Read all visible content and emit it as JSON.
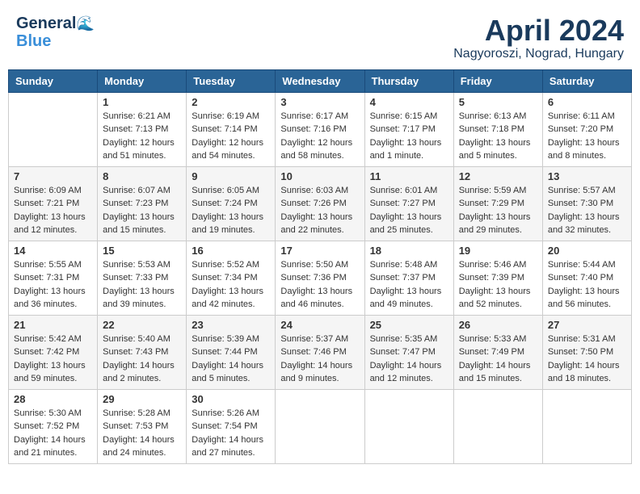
{
  "logo": {
    "line1": "General",
    "line2": "Blue"
  },
  "header": {
    "title": "April 2024",
    "location": "Nagyoroszi, Nograd, Hungary"
  },
  "weekdays": [
    "Sunday",
    "Monday",
    "Tuesday",
    "Wednesday",
    "Thursday",
    "Friday",
    "Saturday"
  ],
  "weeks": [
    [
      {
        "day": "",
        "info": ""
      },
      {
        "day": "1",
        "info": "Sunrise: 6:21 AM\nSunset: 7:13 PM\nDaylight: 12 hours\nand 51 minutes."
      },
      {
        "day": "2",
        "info": "Sunrise: 6:19 AM\nSunset: 7:14 PM\nDaylight: 12 hours\nand 54 minutes."
      },
      {
        "day": "3",
        "info": "Sunrise: 6:17 AM\nSunset: 7:16 PM\nDaylight: 12 hours\nand 58 minutes."
      },
      {
        "day": "4",
        "info": "Sunrise: 6:15 AM\nSunset: 7:17 PM\nDaylight: 13 hours\nand 1 minute."
      },
      {
        "day": "5",
        "info": "Sunrise: 6:13 AM\nSunset: 7:18 PM\nDaylight: 13 hours\nand 5 minutes."
      },
      {
        "day": "6",
        "info": "Sunrise: 6:11 AM\nSunset: 7:20 PM\nDaylight: 13 hours\nand 8 minutes."
      }
    ],
    [
      {
        "day": "7",
        "info": "Sunrise: 6:09 AM\nSunset: 7:21 PM\nDaylight: 13 hours\nand 12 minutes."
      },
      {
        "day": "8",
        "info": "Sunrise: 6:07 AM\nSunset: 7:23 PM\nDaylight: 13 hours\nand 15 minutes."
      },
      {
        "day": "9",
        "info": "Sunrise: 6:05 AM\nSunset: 7:24 PM\nDaylight: 13 hours\nand 19 minutes."
      },
      {
        "day": "10",
        "info": "Sunrise: 6:03 AM\nSunset: 7:26 PM\nDaylight: 13 hours\nand 22 minutes."
      },
      {
        "day": "11",
        "info": "Sunrise: 6:01 AM\nSunset: 7:27 PM\nDaylight: 13 hours\nand 25 minutes."
      },
      {
        "day": "12",
        "info": "Sunrise: 5:59 AM\nSunset: 7:29 PM\nDaylight: 13 hours\nand 29 minutes."
      },
      {
        "day": "13",
        "info": "Sunrise: 5:57 AM\nSunset: 7:30 PM\nDaylight: 13 hours\nand 32 minutes."
      }
    ],
    [
      {
        "day": "14",
        "info": "Sunrise: 5:55 AM\nSunset: 7:31 PM\nDaylight: 13 hours\nand 36 minutes."
      },
      {
        "day": "15",
        "info": "Sunrise: 5:53 AM\nSunset: 7:33 PM\nDaylight: 13 hours\nand 39 minutes."
      },
      {
        "day": "16",
        "info": "Sunrise: 5:52 AM\nSunset: 7:34 PM\nDaylight: 13 hours\nand 42 minutes."
      },
      {
        "day": "17",
        "info": "Sunrise: 5:50 AM\nSunset: 7:36 PM\nDaylight: 13 hours\nand 46 minutes."
      },
      {
        "day": "18",
        "info": "Sunrise: 5:48 AM\nSunset: 7:37 PM\nDaylight: 13 hours\nand 49 minutes."
      },
      {
        "day": "19",
        "info": "Sunrise: 5:46 AM\nSunset: 7:39 PM\nDaylight: 13 hours\nand 52 minutes."
      },
      {
        "day": "20",
        "info": "Sunrise: 5:44 AM\nSunset: 7:40 PM\nDaylight: 13 hours\nand 56 minutes."
      }
    ],
    [
      {
        "day": "21",
        "info": "Sunrise: 5:42 AM\nSunset: 7:42 PM\nDaylight: 13 hours\nand 59 minutes."
      },
      {
        "day": "22",
        "info": "Sunrise: 5:40 AM\nSunset: 7:43 PM\nDaylight: 14 hours\nand 2 minutes."
      },
      {
        "day": "23",
        "info": "Sunrise: 5:39 AM\nSunset: 7:44 PM\nDaylight: 14 hours\nand 5 minutes."
      },
      {
        "day": "24",
        "info": "Sunrise: 5:37 AM\nSunset: 7:46 PM\nDaylight: 14 hours\nand 9 minutes."
      },
      {
        "day": "25",
        "info": "Sunrise: 5:35 AM\nSunset: 7:47 PM\nDaylight: 14 hours\nand 12 minutes."
      },
      {
        "day": "26",
        "info": "Sunrise: 5:33 AM\nSunset: 7:49 PM\nDaylight: 14 hours\nand 15 minutes."
      },
      {
        "day": "27",
        "info": "Sunrise: 5:31 AM\nSunset: 7:50 PM\nDaylight: 14 hours\nand 18 minutes."
      }
    ],
    [
      {
        "day": "28",
        "info": "Sunrise: 5:30 AM\nSunset: 7:52 PM\nDaylight: 14 hours\nand 21 minutes."
      },
      {
        "day": "29",
        "info": "Sunrise: 5:28 AM\nSunset: 7:53 PM\nDaylight: 14 hours\nand 24 minutes."
      },
      {
        "day": "30",
        "info": "Sunrise: 5:26 AM\nSunset: 7:54 PM\nDaylight: 14 hours\nand 27 minutes."
      },
      {
        "day": "",
        "info": ""
      },
      {
        "day": "",
        "info": ""
      },
      {
        "day": "",
        "info": ""
      },
      {
        "day": "",
        "info": ""
      }
    ]
  ]
}
